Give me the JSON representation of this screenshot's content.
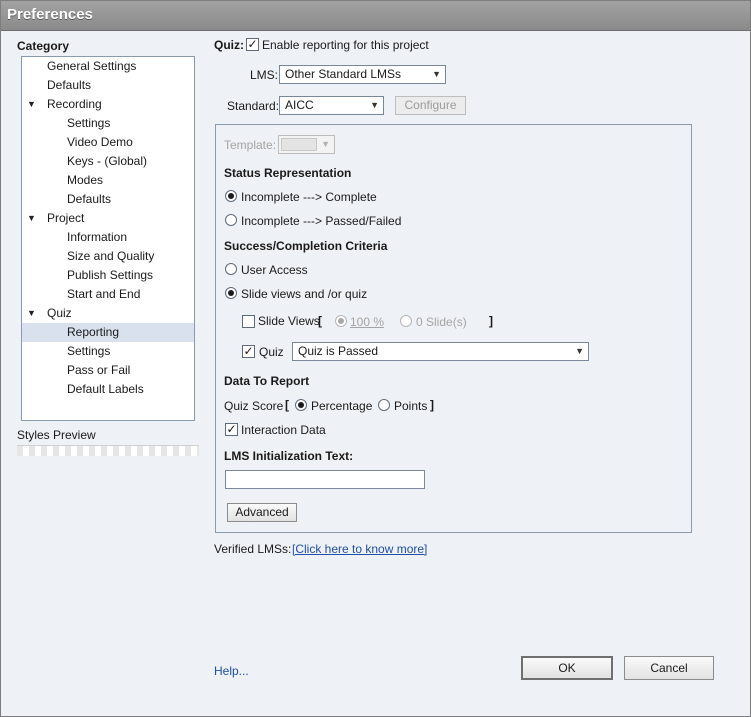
{
  "window": {
    "title": "Preferences"
  },
  "sidebar": {
    "category_label": "Category",
    "items": [
      {
        "label": "General Settings",
        "level": 0,
        "group": false
      },
      {
        "label": "Defaults",
        "level": 0,
        "group": false
      },
      {
        "label": "Recording",
        "level": 0,
        "group": true
      },
      {
        "label": "Settings",
        "level": 1,
        "group": false
      },
      {
        "label": "Video Demo",
        "level": 1,
        "group": false
      },
      {
        "label": "Keys - (Global)",
        "level": 1,
        "group": false
      },
      {
        "label": "Modes",
        "level": 1,
        "group": false
      },
      {
        "label": "Defaults",
        "level": 1,
        "group": false
      },
      {
        "label": "Project",
        "level": 0,
        "group": true
      },
      {
        "label": "Information",
        "level": 1,
        "group": false
      },
      {
        "label": "Size and Quality",
        "level": 1,
        "group": false
      },
      {
        "label": "Publish Settings",
        "level": 1,
        "group": false
      },
      {
        "label": "Start and End",
        "level": 1,
        "group": false
      },
      {
        "label": "Quiz",
        "level": 0,
        "group": true
      },
      {
        "label": "Reporting",
        "level": 1,
        "group": false,
        "selected": true
      },
      {
        "label": "Settings",
        "level": 1,
        "group": false
      },
      {
        "label": "Pass or Fail",
        "level": 1,
        "group": false
      },
      {
        "label": "Default Labels",
        "level": 1,
        "group": false
      }
    ],
    "styles_preview_label": "Styles Preview"
  },
  "reporting": {
    "quiz_label": "Quiz:",
    "enable_label": "Enable reporting for this project",
    "enable_checked": true,
    "lms_label": "LMS:",
    "lms_value": "Other Standard LMSs",
    "standard_label": "Standard:",
    "standard_value": "AICC",
    "configure_label": "Configure",
    "template_label": "Template:",
    "status_heading": "Status Representation",
    "status_opt1": "Incomplete ---> Complete",
    "status_opt2": "Incomplete ---> Passed/Failed",
    "status_selected": 1,
    "criteria_heading": "Success/Completion Criteria",
    "criteria_opt1": "User Access",
    "criteria_opt2": "Slide views and /or quiz",
    "criteria_selected": 2,
    "slide_views_label": "Slide Views",
    "slide_views_checked": false,
    "bracket_open": "[",
    "bracket_close": "]",
    "percent_value": "100 %",
    "slides_value": "0 Slide(s)",
    "quiz_check_label": "Quiz",
    "quiz_checked": true,
    "quiz_condition_value": "Quiz is Passed",
    "data_heading": "Data To Report",
    "quiz_score_label": "Quiz Score",
    "percentage_label": "Percentage",
    "points_label": "Points",
    "score_selected": "percentage",
    "interaction_label": "Interaction Data",
    "interaction_checked": true,
    "lms_init_heading": "LMS Initialization Text:",
    "lms_init_value": "",
    "advanced_label": "Advanced",
    "verified_label": "Verified LMSs:",
    "verified_link": "[Click here to know more]"
  },
  "footer": {
    "help_label": "Help...",
    "ok_label": "OK",
    "cancel_label": "Cancel"
  }
}
